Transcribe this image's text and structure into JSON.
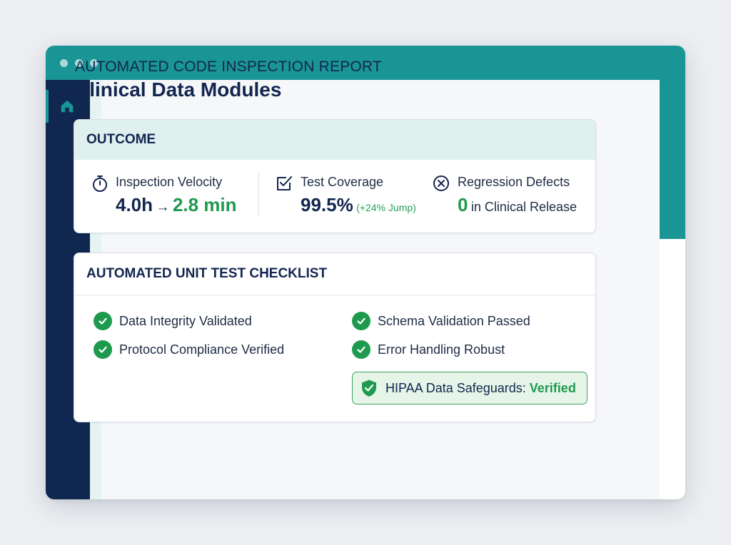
{
  "report": {
    "label": "AUTOMATED CODE INSPECTION REPORT",
    "title": "Clinical Data Modules"
  },
  "sidebar": {
    "items": [
      {
        "icon": "home-icon",
        "active": true
      }
    ]
  },
  "outcome": {
    "heading": "OUTCOME",
    "metrics": {
      "velocity": {
        "icon": "stopwatch-icon",
        "label": "Inspection Velocity",
        "from": "4.0h",
        "arrow": "→",
        "to": "2.8 min"
      },
      "coverage": {
        "icon": "checkbox-icon",
        "label": "Test Coverage",
        "value": "99.5%",
        "note": "(+24% Jump)"
      },
      "defects": {
        "icon": "x-circle-icon",
        "label": "Regression Defects",
        "value": "0",
        "suffix": "in Clinical Release"
      }
    }
  },
  "checklist": {
    "heading": "AUTOMATED UNIT TEST CHECKLIST",
    "items": [
      {
        "label": "Data Integrity Validated",
        "icon": "check-circle-icon"
      },
      {
        "label": "Schema Validation Passed",
        "icon": "check-circle-icon"
      },
      {
        "label": "Protocol Compliance Verified",
        "icon": "check-circle-icon"
      },
      {
        "label": "Error Handling Robust",
        "icon": "check-circle-icon"
      }
    ],
    "badge": {
      "icon": "shield-check-icon",
      "label": "HIPAA Data Safeguards: ",
      "status": "Verified"
    }
  },
  "colors": {
    "teal": "#1a9595",
    "navy": "#10274f",
    "green": "#1f9a4e",
    "header_tint": "#dff0ef",
    "badge_bg": "#e6f5e8"
  }
}
